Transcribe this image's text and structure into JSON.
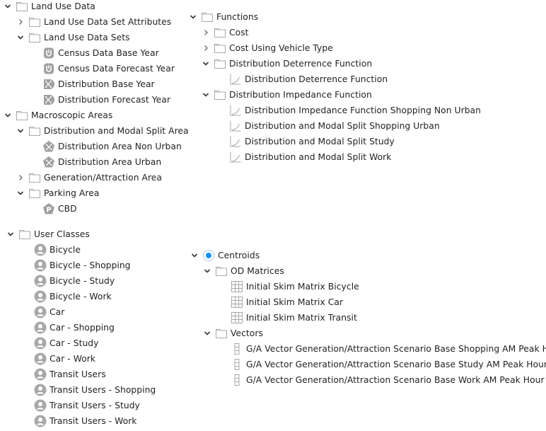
{
  "trees": {
    "land_use": {
      "label": "Land Use Data",
      "children": [
        {
          "label": "Land Use Data Set Attributes"
        },
        {
          "label": "Land Use Data Sets",
          "children": [
            {
              "label": "Census Data Base Year",
              "icon": "census-icon"
            },
            {
              "label": "Census Data Forecast Year",
              "icon": "census-icon"
            },
            {
              "label": "Distribution Base Year",
              "icon": "distribution-icon"
            },
            {
              "label": "Distribution Forecast Year",
              "icon": "distribution-icon"
            }
          ]
        }
      ]
    },
    "macroscopic": {
      "label": "Macroscopic Areas",
      "children": [
        {
          "label": "Distribution and Modal Split Area",
          "children": [
            {
              "label": "Distribution Area Non Urban",
              "icon": "distribution-area-icon"
            },
            {
              "label": "Distribution Area Urban",
              "icon": "distribution-area-icon"
            }
          ]
        },
        {
          "label": "Generation/Attraction Area"
        },
        {
          "label": "Parking Area",
          "children": [
            {
              "label": "CBD",
              "icon": "parking-icon"
            }
          ]
        }
      ]
    },
    "user_classes": {
      "label": "User Classes",
      "children": [
        {
          "label": "Bicycle"
        },
        {
          "label": "Bicycle - Shopping"
        },
        {
          "label": "Bicycle - Study"
        },
        {
          "label": "Bicycle - Work"
        },
        {
          "label": "Car"
        },
        {
          "label": "Car - Shopping"
        },
        {
          "label": "Car - Study"
        },
        {
          "label": "Car - Work"
        },
        {
          "label": "Transit Users"
        },
        {
          "label": "Transit Users - Shopping"
        },
        {
          "label": "Transit Users - Study"
        },
        {
          "label": "Transit Users - Work"
        }
      ]
    },
    "functions": {
      "label": "Functions",
      "children": [
        {
          "label": "Cost"
        },
        {
          "label": "Cost Using Vehicle Type"
        },
        {
          "label": "Distribution Deterrence Function",
          "children": [
            {
              "label": "Distribution Deterrence Function"
            }
          ]
        },
        {
          "label": "Distribution Impedance Function",
          "children": [
            {
              "label": "Distribution Impedance Function Shopping Non Urban"
            },
            {
              "label": "Distribution and Modal Split Shopping Urban"
            },
            {
              "label": "Distribution and Modal Split Study"
            },
            {
              "label": "Distribution and Modal Split Work"
            }
          ]
        }
      ]
    },
    "centroids": {
      "label": "Centroids",
      "children": [
        {
          "label": "OD Matrices",
          "children": [
            {
              "label": "Initial Skim Matrix Bicycle"
            },
            {
              "label": "Initial Skim Matrix Car"
            },
            {
              "label": "Initial Skim Matrix Transit"
            }
          ]
        },
        {
          "label": "Vectors",
          "children": [
            {
              "label": "G/A Vector Generation/Attraction Scenario Base Shopping AM Peak Hour"
            },
            {
              "label": "G/A Vector Generation/Attraction Scenario Base Study AM Peak Hour"
            },
            {
              "label": "G/A Vector Generation/Attraction Scenario Base Work AM Peak Hour"
            }
          ]
        }
      ]
    }
  },
  "colors": {
    "chevron": "#333333",
    "folder_stroke": "#a8a8a8",
    "icon_gray": "#a0a0a0",
    "radio_accent": "#1e90ff",
    "text": "#222222"
  }
}
